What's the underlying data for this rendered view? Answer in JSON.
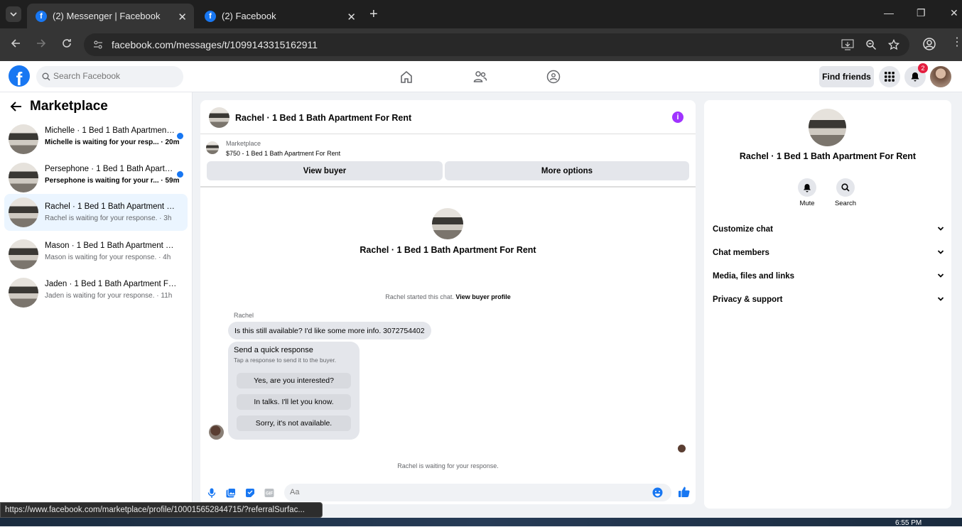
{
  "browser": {
    "tabs": [
      {
        "label": "(2) Messenger | Facebook",
        "active": true
      },
      {
        "label": "(2) Facebook",
        "active": false
      }
    ],
    "url": "facebook.com/messages/t/1099143315162911"
  },
  "header": {
    "search_placeholder": "Search Facebook",
    "find_friends": "Find friends",
    "notification_count": "2"
  },
  "sidebar": {
    "title": "Marketplace",
    "conversations": [
      {
        "name": "Michelle · 1 Bed 1 Bath Apartment For Rent",
        "preview": "Michelle is waiting for your resp... · 20m",
        "unread": true,
        "selected": false
      },
      {
        "name": "Persephone · 1 Bed 1 Bath Apartment For Rent",
        "preview": "Persephone is waiting for your r... · 59m",
        "unread": true,
        "selected": false
      },
      {
        "name": "Rachel · 1 Bed 1 Bath Apartment For Rent",
        "preview": "Rachel is waiting for your response. · 3h",
        "unread": false,
        "selected": true
      },
      {
        "name": "Mason · 1 Bed 1 Bath Apartment For Rent",
        "preview": "Mason is waiting for your response. · 4h",
        "unread": false,
        "selected": false
      },
      {
        "name": "Jaden · 1 Bed 1 Bath Apartment For Rent",
        "preview": "Jaden is waiting for your response. · 11h",
        "unread": false,
        "selected": false
      }
    ]
  },
  "chat": {
    "title": "Rachel · 1 Bed 1 Bath Apartment For Rent",
    "listing": {
      "category": "Marketplace",
      "price_line": "$750 - 1 Bed 1 Bath Apartment For Rent",
      "view_buyer": "View buyer",
      "more_options": "More options"
    },
    "center_name": "Rachel · 1 Bed 1 Bath Apartment For Rent",
    "started_text": "Rachel started this chat.",
    "view_profile": "View buyer profile",
    "sender": "Rachel",
    "message": "Is this still available? I'd like some more info. 3072754402",
    "quick": {
      "title": "Send a quick response",
      "subtitle": "Tap a response to send it to the buyer.",
      "options": [
        "Yes, are you interested?",
        "In talks. I'll let you know.",
        "Sorry, it's not available."
      ]
    },
    "waiting": "Rachel is waiting for your response.",
    "input_placeholder": "Aa"
  },
  "right_panel": {
    "name": "Rachel · 1 Bed 1 Bath Apartment For Rent",
    "mute": "Mute",
    "search": "Search",
    "sections": [
      "Customize chat",
      "Chat members",
      "Media, files and links",
      "Privacy & support"
    ]
  },
  "status_url": "https://www.facebook.com/marketplace/profile/100015652844715/?referralSurfac...",
  "clock": "6:55 PM",
  "colors": {
    "brand": "#1877f2",
    "accent": "#a033ff",
    "badge": "#e41e3f"
  }
}
